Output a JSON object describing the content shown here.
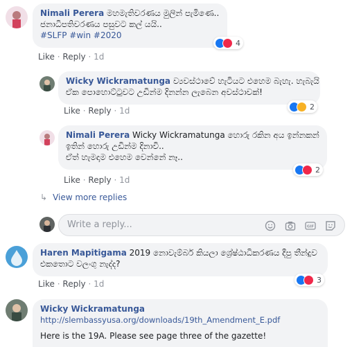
{
  "comments": [
    {
      "author": "Nimali Perera",
      "lines": [
        "මහමැතිවරණය මුලින් පැමිණෙ..",
        "ජනාධිපතිවරණය පසුවට කල් යයි..",
        "#SLFP #win #2020"
      ],
      "actions": {
        "like": "Like",
        "reply": "Reply",
        "time": "1d"
      },
      "reactions": {
        "count": "4",
        "types": [
          "like-icon",
          "love-icon"
        ]
      }
    },
    {
      "author": "Wicky Wickramatunga",
      "lines": [
        "ව්‍යවස්ථාවේ හැටියට එහෙම බැහැ. හැබැයි",
        "ඒක පොහොට්ටුවට උඩින්ම දිනන්න ලැබෙන අවස්ථාවක්!"
      ],
      "actions": {
        "like": "Like",
        "reply": "Reply",
        "time": "1d"
      },
      "reactions": {
        "count": "2",
        "types": [
          "like-icon",
          "haha-icon"
        ]
      }
    },
    {
      "author": "Nimali Perera",
      "mention": "Wicky Wickramatunga",
      "lines": [
        "හොරු රකින අය ඉන්නකන්",
        "ඉතින් හොරු උඩින්ම දිනාවි..",
        "ඒත් හැමදාම එහෙම වෙන්නේ නෑ.."
      ],
      "actions": {
        "like": "Like",
        "reply": "Reply",
        "time": "1d"
      },
      "reactions": {
        "count": "2",
        "types": [
          "like-icon",
          "love-icon"
        ]
      }
    },
    {
      "author": "Haren Mapitigama",
      "lines": [
        "2019 නොවැම්බර් කියලා ශ්‍රේෂ්ඨාධිකරණය දීපු තීන්දුව",
        "එකතොට වලංගු නැද්ද?"
      ],
      "actions": {
        "like": "Like",
        "reply": "Reply",
        "time": "1d"
      },
      "reactions": {
        "count": "3",
        "types": [
          "like-icon",
          "love-icon"
        ]
      }
    },
    {
      "author": "Wicky Wickramatunga",
      "link": "http://slembassyusa.org/downloads/19th_Amendment_E.pdf",
      "text": "Here is the 19A. Please see page three of the gazette!"
    }
  ],
  "view_more": "View more replies",
  "reply_input": {
    "placeholder": "Write a reply...",
    "value": ""
  },
  "colors": {
    "link": "#385898",
    "bubble": "#f2f3f5",
    "like": "#1877f2",
    "love": "#f0284a",
    "haha": "#f7b125"
  }
}
